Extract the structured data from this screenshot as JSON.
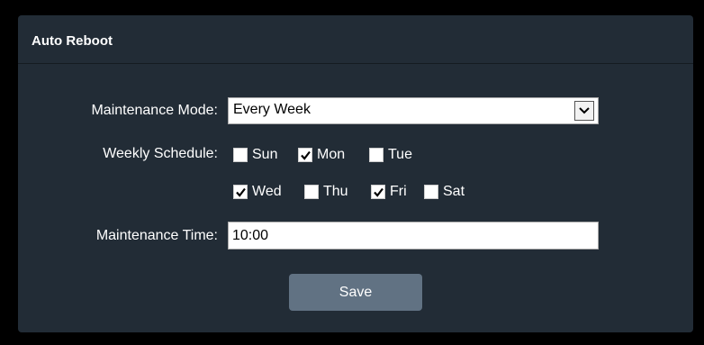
{
  "panel": {
    "title": "Auto Reboot"
  },
  "form": {
    "maintenance_mode": {
      "label": "Maintenance Mode:",
      "value": "Every Week"
    },
    "weekly_schedule": {
      "label": "Weekly Schedule:",
      "days": [
        {
          "label": "Sun",
          "checked": false
        },
        {
          "label": "Mon",
          "checked": true
        },
        {
          "label": "Tue",
          "checked": false
        },
        {
          "label": "Wed",
          "checked": true
        },
        {
          "label": "Thu",
          "checked": false
        },
        {
          "label": "Fri",
          "checked": true
        },
        {
          "label": "Sat",
          "checked": false
        }
      ]
    },
    "maintenance_time": {
      "label": "Maintenance Time:",
      "value": "10:00"
    },
    "save_label": "Save"
  },
  "colors": {
    "page_background": "#000000",
    "panel_background": "#222c36",
    "button_background": "#617283",
    "text": "#ffffff"
  }
}
